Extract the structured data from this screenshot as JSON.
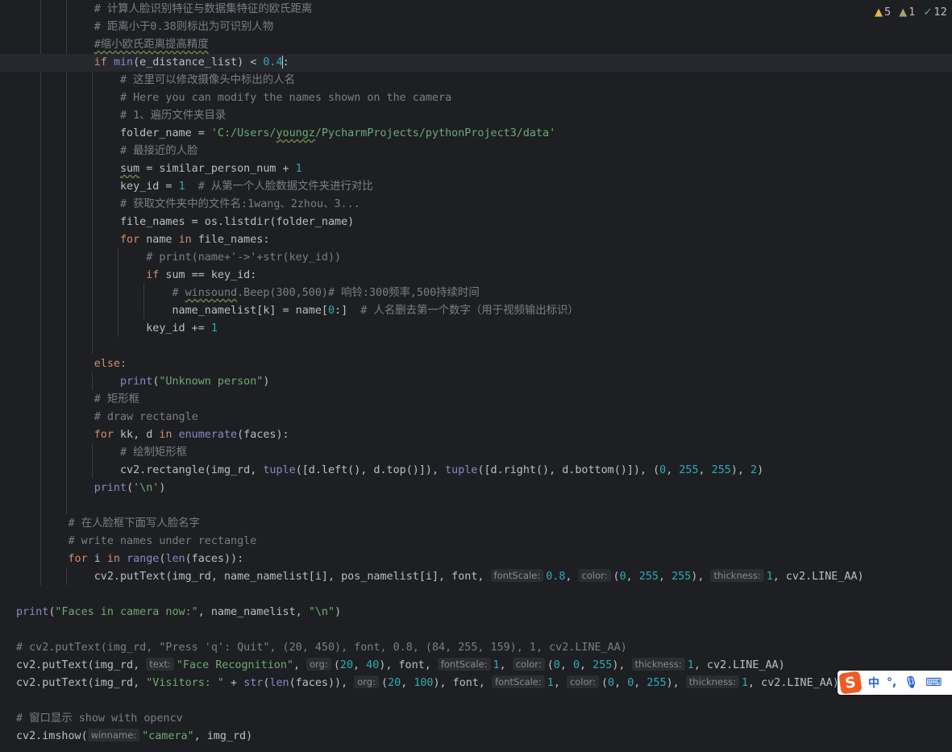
{
  "inspections": {
    "warnings": "5",
    "weak_warnings": "1",
    "typos": "12"
  },
  "code": {
    "l1_comment": "# 计算人脸识别特征与数据集特征的欧氏距离",
    "l2_comment": "# 距离小于0.38则标出为可识别人物",
    "l3_comment": "#缩小欧氏距离提高精度",
    "l4_if": "if",
    "l4_min": "min",
    "l4_args": "(e_distance_list) < ",
    "l4_num_a": "0.4",
    "l4_colon": ":",
    "l5": "# 这里可以修改摄像头中标出的人名",
    "l6": "# Here you can modify the names shown on the camera",
    "l7": "# 1、遍历文件夹目录",
    "l8_a": "folder_name = ",
    "l8_str_a": "'C:/Users/",
    "l8_str_typo": "youngz",
    "l8_str_b": "/PycharmProjects/pythonProject3/data'",
    "l9": "# 最接近的人脸",
    "l10_sum": "sum",
    "l10_a": " = similar_person_num + ",
    "l10_num": "1",
    "l11_a": "key_id = ",
    "l11_num": "1",
    "l11_cm": "  # 从第一个人脸数据文件夹进行对比",
    "l12": "# 获取文件夹中的文件名:1wang、2zhou、3...",
    "l13": "file_names = os.listdir(folder_name)",
    "l14_for": "for",
    "l14_a": " name ",
    "l14_in": "in",
    "l14_b": " file_names:",
    "l15": "# print(name+'->'+str(key_id))",
    "l16_if": "if",
    "l16_a": " sum == key_id:",
    "l17_a": "# ",
    "l17_typo": "winsound",
    "l17_b": ".Beep(300,500)# 响铃:300频率,500持续时间",
    "l18_a": "name_namelist[k] = name[",
    "l18_num": "0",
    "l18_b": ":]",
    "l18_cm": "  # 人名删去第一个数字（用于视频输出标识）",
    "l19_a": "key_id += ",
    "l19_num": "1",
    "l21": "else:",
    "l22_print": "print",
    "l22_str": "\"Unknown person\"",
    "l23": "# 矩形框",
    "l24": "# draw rectangle",
    "l25_for": "for",
    "l25_a": " kk, d ",
    "l25_in": "in",
    "l25_enum": "enumerate",
    "l25_b": "(faces):",
    "l26": "# 绘制矩形框",
    "l27_a": "cv2.rectangle(img_rd, ",
    "l27_tuple1": "tuple",
    "l27_b": "([d.left(), d.top()]), ",
    "l27_tuple2": "tuple",
    "l27_c": "([d.right(), d.bottom()]), (",
    "l27_n1": "0",
    "l27_n2": "255",
    "l27_n3": "255",
    "l27_n4": "2",
    "l28_print": "print",
    "l28_str": "'\\n'",
    "l30": "# 在人脸框下面写人脸名字",
    "l31": "# write names under rectangle",
    "l32_for": "for",
    "l32_a": " i ",
    "l32_in": "in",
    "l32_range": "range",
    "l32_len": "len",
    "l32_b": "(faces)):",
    "l33_a": "cv2.putText(img_rd, name_namelist[i], pos_namelist[i], font, ",
    "l33_h1": "fontScale:",
    "l33_n1": "0.8",
    "l33_h2": "color:",
    "l33_n2": "0",
    "l33_n3": "255",
    "l33_n4": "255",
    "l33_h3": "thickness:",
    "l33_n5": "1",
    "l33_b": ", cv2.LINE_AA)",
    "l35_print": "print",
    "l35_str1": "\"Faces in camera now:\"",
    "l35_a": ", name_namelist, ",
    "l35_str2": "\"\\n\"",
    "l37": "# cv2.putText(img_rd, \"Press 'q': Quit\", (20, 450), font, 0.8, (84, 255, 159), 1, cv2.LINE_AA)",
    "l38_a": "cv2.putText(img_rd, ",
    "l38_h1": "text:",
    "l38_str": "\"Face Recognition\"",
    "l38_h2": "org:",
    "l38_n1": "20",
    "l38_n2": "40",
    "l38_h3": "fontScale:",
    "l38_n3": "1",
    "l38_h4": "color:",
    "l38_n4": "0",
    "l38_n5": "0",
    "l38_n6": "255",
    "l38_h5": "thickness:",
    "l38_n7": "1",
    "l38_b": ", cv2.LINE_AA)",
    "l39_a": "cv2.putText(img_rd, ",
    "l39_str": "\"Visitors: \"",
    "l39_b": " + ",
    "l39_str_fn": "str",
    "l39_len": "len",
    "l39_c": "(faces)), ",
    "l39_h1": "org:",
    "l39_n1": "20",
    "l39_n2": "100",
    "l39_h2": "fontScale:",
    "l39_n3": "1",
    "l39_h3": "color:",
    "l39_n4": "0",
    "l39_n5": "0",
    "l39_n6": "255",
    "l39_h4": "thickness:",
    "l39_n7": "1",
    "l39_d": ", cv2.LINE_AA)",
    "l41": "# 窗口显示 show with opencv",
    "l42_a": "cv2.imshow(",
    "l42_h1": "winname:",
    "l42_str": "\"camera\"",
    "l42_b": ", img_rd)"
  },
  "ime": {
    "logo": "S",
    "lang": "中",
    "punct": "°,",
    "mic": "🎙",
    "keyboard": "⌨"
  }
}
